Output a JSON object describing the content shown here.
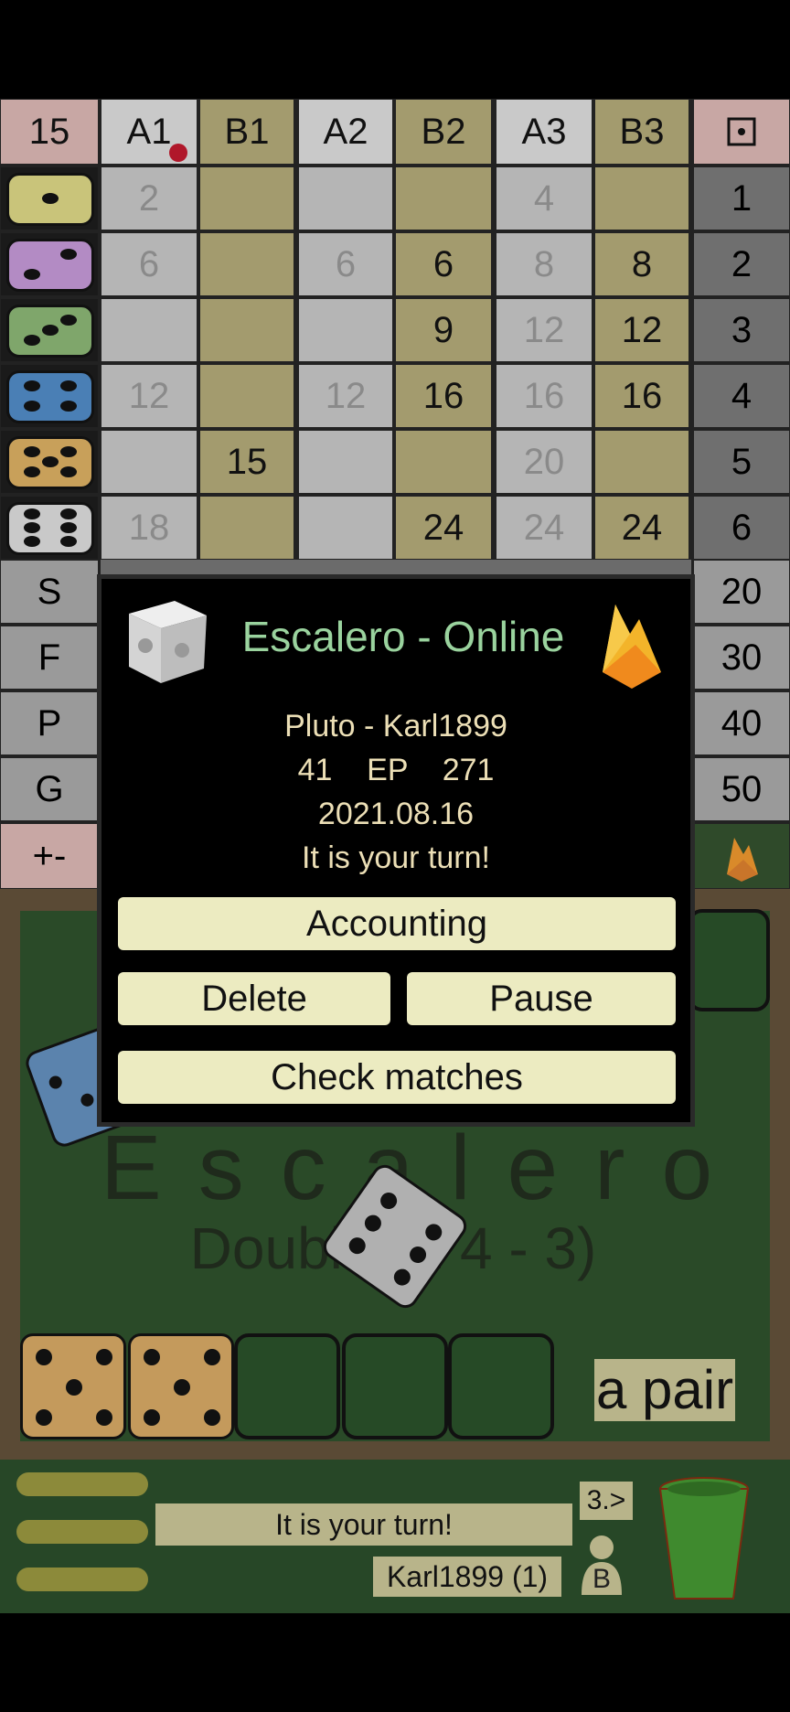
{
  "scoreboard": {
    "corner": "15",
    "columns": [
      "A1",
      "B1",
      "A2",
      "B2",
      "A3",
      "B3"
    ],
    "end_icon": "square-dot-icon",
    "rows": [
      {
        "cells": [
          "2",
          "",
          "",
          "",
          "4",
          ""
        ],
        "sum": "1"
      },
      {
        "cells": [
          "6",
          "",
          "6",
          "6",
          "8",
          "8"
        ],
        "sum": "2"
      },
      {
        "cells": [
          "",
          "",
          "",
          "9",
          "12",
          "12"
        ],
        "sum": "3"
      },
      {
        "cells": [
          "12",
          "",
          "12",
          "16",
          "16",
          "16"
        ],
        "sum": "4"
      },
      {
        "cells": [
          "",
          "15",
          "",
          "",
          "20",
          ""
        ],
        "sum": "5"
      },
      {
        "cells": [
          "18",
          "",
          "",
          "24",
          "24",
          "24"
        ],
        "sum": "6"
      }
    ],
    "specials": [
      {
        "label": "S",
        "value": "20"
      },
      {
        "label": "F",
        "value": "30"
      },
      {
        "label": "P",
        "value": "40"
      },
      {
        "label": "G",
        "value": "50"
      }
    ],
    "plusminus": "+-",
    "row_die_colors": [
      "#c9c47a",
      "#b38bc4",
      "#7fa66b",
      "#4a7fb5",
      "#c8a05a",
      "#c9c9c9"
    ]
  },
  "dialog": {
    "title": "Escalero - Online",
    "players": "Pluto - Karl1899",
    "score_line": "41    EP    271",
    "date": "2021.08.16",
    "status": "It is your turn!",
    "buttons": {
      "accounting": "Accounting",
      "delete": "Delete",
      "pause": "Pause",
      "check": "Check matches"
    }
  },
  "board": {
    "watermark_title": "Escalero",
    "watermark_sub": "Double (2 4 - 3)",
    "combo_label": "a pair"
  },
  "bottom": {
    "message": "It is your turn!",
    "player": "Karl1899 (1)",
    "rank": "3.>",
    "player_letter": "B"
  }
}
